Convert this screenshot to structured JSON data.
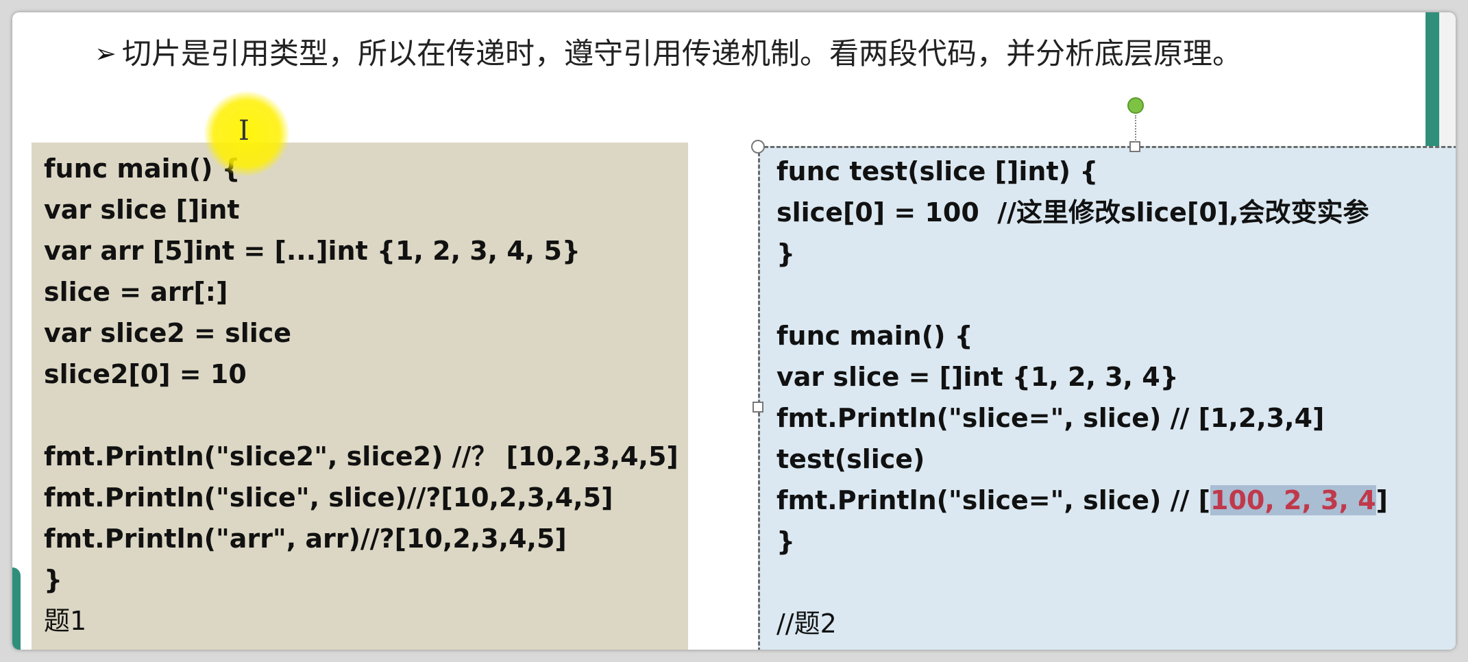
{
  "bullet": {
    "text": "切片是引用类型，所以在传递时，遵守引用传递机制。看两段代码，并分析底层原理。"
  },
  "box1": {
    "lines": [
      "func main() {",
      "var slice []int",
      "var arr [5]int = [...]int {1, 2, 3, 4, 5}",
      "slice = arr[:]",
      "var slice2 = slice",
      "slice2[0] = 10",
      "",
      "fmt.Println(\"slice2\", slice2) //？ [10,2,3,4,5]",
      "fmt.Println(\"slice\", slice)//?[10,2,3,4,5]",
      "fmt.Println(\"arr\", arr)//?[10,2,3,4,5]",
      "}"
    ],
    "caption": "题1"
  },
  "box2": {
    "lines": [
      "func test(slice []int) {",
      "slice[0] = 100  //这里修改slice[0],会改变实参",
      "}",
      "",
      "func main() {",
      "var slice = []int {1, 2, 3, 4}",
      "fmt.Println(\"slice=\", slice) // [1,2,3,4]",
      "test(slice)"
    ],
    "line9_prefix": "fmt.Println(\"slice=\", slice) // [",
    "line9_highlight": "100, 2, 3, 4",
    "line9_suffix": "]",
    "close": "}",
    "caption": "//题2"
  },
  "colors": {
    "box1_bg": "#dcd7c4",
    "box2_bg": "#dbe8f1",
    "highlight_text": "#c0394b",
    "accent": "#2f8f7b"
  },
  "icons": [
    "bullet-arrow-icon",
    "text-cursor-icon",
    "rotate-handle-icon"
  ]
}
